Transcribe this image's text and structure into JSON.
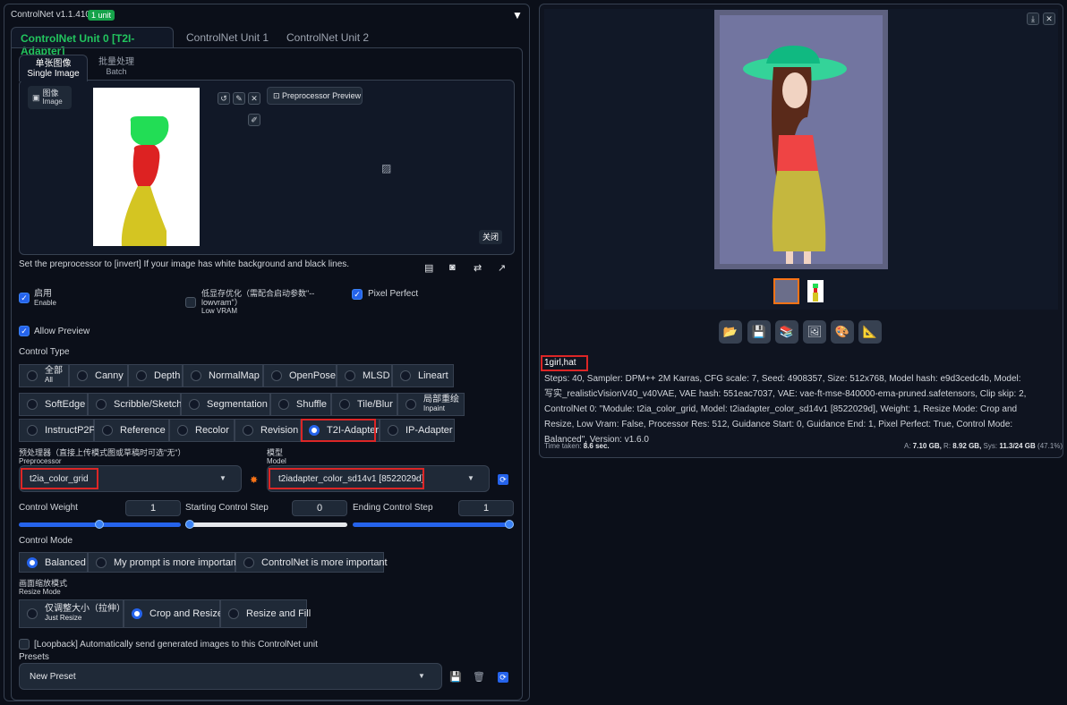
{
  "header": {
    "title": "ControlNet v1.1.410",
    "badge": "1 unit",
    "collapse": "▼"
  },
  "tabs": [
    "ControlNet Unit 0 [T2I-Adapter]",
    "ControlNet Unit 1",
    "ControlNet Unit 2"
  ],
  "image_tabs": {
    "single_cn": "单张图像",
    "single_en": "Single Image",
    "batch_cn": "批量处理",
    "batch_en": "Batch"
  },
  "image_label": {
    "cn": "图像",
    "en": "Image"
  },
  "preview_button": "Preprocessor Preview",
  "close_button": "关闭",
  "hint": "Set the preprocessor to [invert] If your image has white background and black lines.",
  "enable": {
    "cn": "启用",
    "en": "Enable"
  },
  "lowvram": {
    "cn": "低显存优化（需配合启动参数\"--lowvram\"）",
    "en": "Low VRAM"
  },
  "pixel_perfect": "Pixel Perfect",
  "allow_preview": "Allow Preview",
  "control_type_label": "Control Type",
  "control_types": [
    {
      "cn": "全部",
      "en": "All"
    },
    {
      "label": "Canny"
    },
    {
      "label": "Depth"
    },
    {
      "label": "NormalMap"
    },
    {
      "label": "OpenPose"
    },
    {
      "label": "MLSD"
    },
    {
      "label": "Lineart"
    },
    {
      "label": "SoftEdge"
    },
    {
      "label": "Scribble/Sketch"
    },
    {
      "label": "Segmentation"
    },
    {
      "label": "Shuffle"
    },
    {
      "label": "Tile/Blur"
    },
    {
      "cn": "局部重绘",
      "en": "Inpaint"
    },
    {
      "label": "InstructP2P"
    },
    {
      "label": "Reference"
    },
    {
      "label": "Recolor"
    },
    {
      "label": "Revision"
    },
    {
      "label": "T2I-Adapter"
    },
    {
      "label": "IP-Adapter"
    }
  ],
  "preprocessor": {
    "cn": "预处理器（直接上传模式图或草稿时可选\"无\"）",
    "en": "Preprocessor",
    "value": "t2ia_color_grid"
  },
  "model": {
    "cn": "模型",
    "en": "Model",
    "value": "t2iadapter_color_sd14v1 [8522029d]"
  },
  "sliders": {
    "weight_label": "Control Weight",
    "weight": "1",
    "start_label": "Starting Control Step",
    "start": "0",
    "end_label": "Ending Control Step",
    "end": "1"
  },
  "control_mode_label": "Control Mode",
  "control_modes": [
    "Balanced",
    "My prompt is more important",
    "ControlNet is more important"
  ],
  "resize_label": {
    "cn": "画面缩放模式",
    "en": "Resize Mode"
  },
  "resize_modes": [
    {
      "cn": "仅调整大小（拉伸）",
      "en": "Just Resize"
    },
    {
      "label": "Crop and Resize"
    },
    {
      "label": "Resize and Fill"
    }
  ],
  "loopback": "[Loopback] Automatically send generated images to this ControlNet unit",
  "presets_label": "Presets",
  "preset_value": "New Preset",
  "prompt": "1girl,hat",
  "info": "Steps: 40, Sampler: DPM++ 2M Karras, CFG scale: 7, Seed: 4908357, Size: 512x768, Model hash: e9d3cedc4b, Model: 写实_realisticVisionV40_v40VAE, VAE hash: 551eac7037, VAE: vae-ft-mse-840000-ema-pruned.safetensors, Clip skip: 2, ControlNet 0: \"Module: t2ia_color_grid, Model: t2iadapter_color_sd14v1 [8522029d], Weight: 1, Resize Mode: Crop and Resize, Low Vram: False, Processor Res: 512, Guidance Start: 0, Guidance End: 1, Pixel Perfect: True, Control Mode: Balanced\", Version: v1.6.0",
  "time_label": "Time taken:",
  "time_value": "8.6 sec.",
  "mem": {
    "a_label": "A:",
    "a": "7.10 GB,",
    "r_label": "R:",
    "r": "8.92 GB,",
    "sys_label": "Sys:",
    "sys": "11.3/24 GB",
    "pct": "(47.1%)"
  },
  "icons": {
    "folder": "📂",
    "save": "💾",
    "zip": "📚",
    "image": "🖼",
    "palette": "🎨",
    "triangle": "📐"
  },
  "colors": {
    "accent": "#22c55e",
    "blue": "#2563eb",
    "red": "#dc2626"
  }
}
